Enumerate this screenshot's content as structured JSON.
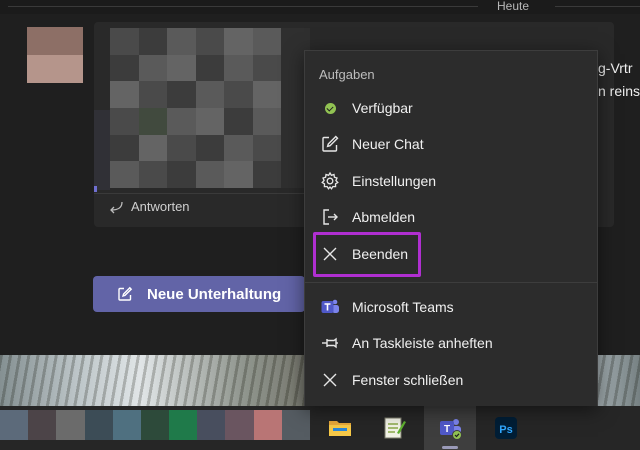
{
  "chat": {
    "day_label": "Heute",
    "reply_label": "Antworten",
    "truncated_line_1": "g-Vrtr",
    "truncated_line_2": "n reins",
    "new_conversation_label": "Neue Unterhaltung"
  },
  "jump_list": {
    "header": "Aufgaben",
    "items": [
      {
        "label": "Verfügbar",
        "icon": "status-available-icon"
      },
      {
        "label": "Neuer Chat",
        "icon": "compose-icon"
      },
      {
        "label": "Einstellungen",
        "icon": "gear-icon"
      },
      {
        "label": "Abmelden",
        "icon": "sign-out-icon"
      },
      {
        "label": "Beenden",
        "icon": "close-icon"
      }
    ],
    "app_items": [
      {
        "label": "Microsoft Teams",
        "icon": "teams-icon"
      },
      {
        "label": "An Taskleiste anheften",
        "icon": "pin-icon"
      },
      {
        "label": "Fenster schließen",
        "icon": "close-icon"
      }
    ],
    "highlight_color": "#b02fd1"
  },
  "taskbar": {
    "apps": [
      "explorer-icon",
      "notepad-icon",
      "teams-icon",
      "photoshop-icon"
    ],
    "photoshop_label": "Ps",
    "teams_label": "T"
  },
  "colors": {
    "accent": "#6264a7",
    "status_available": "#92c353",
    "menu_bg": "#2c2c2c"
  }
}
